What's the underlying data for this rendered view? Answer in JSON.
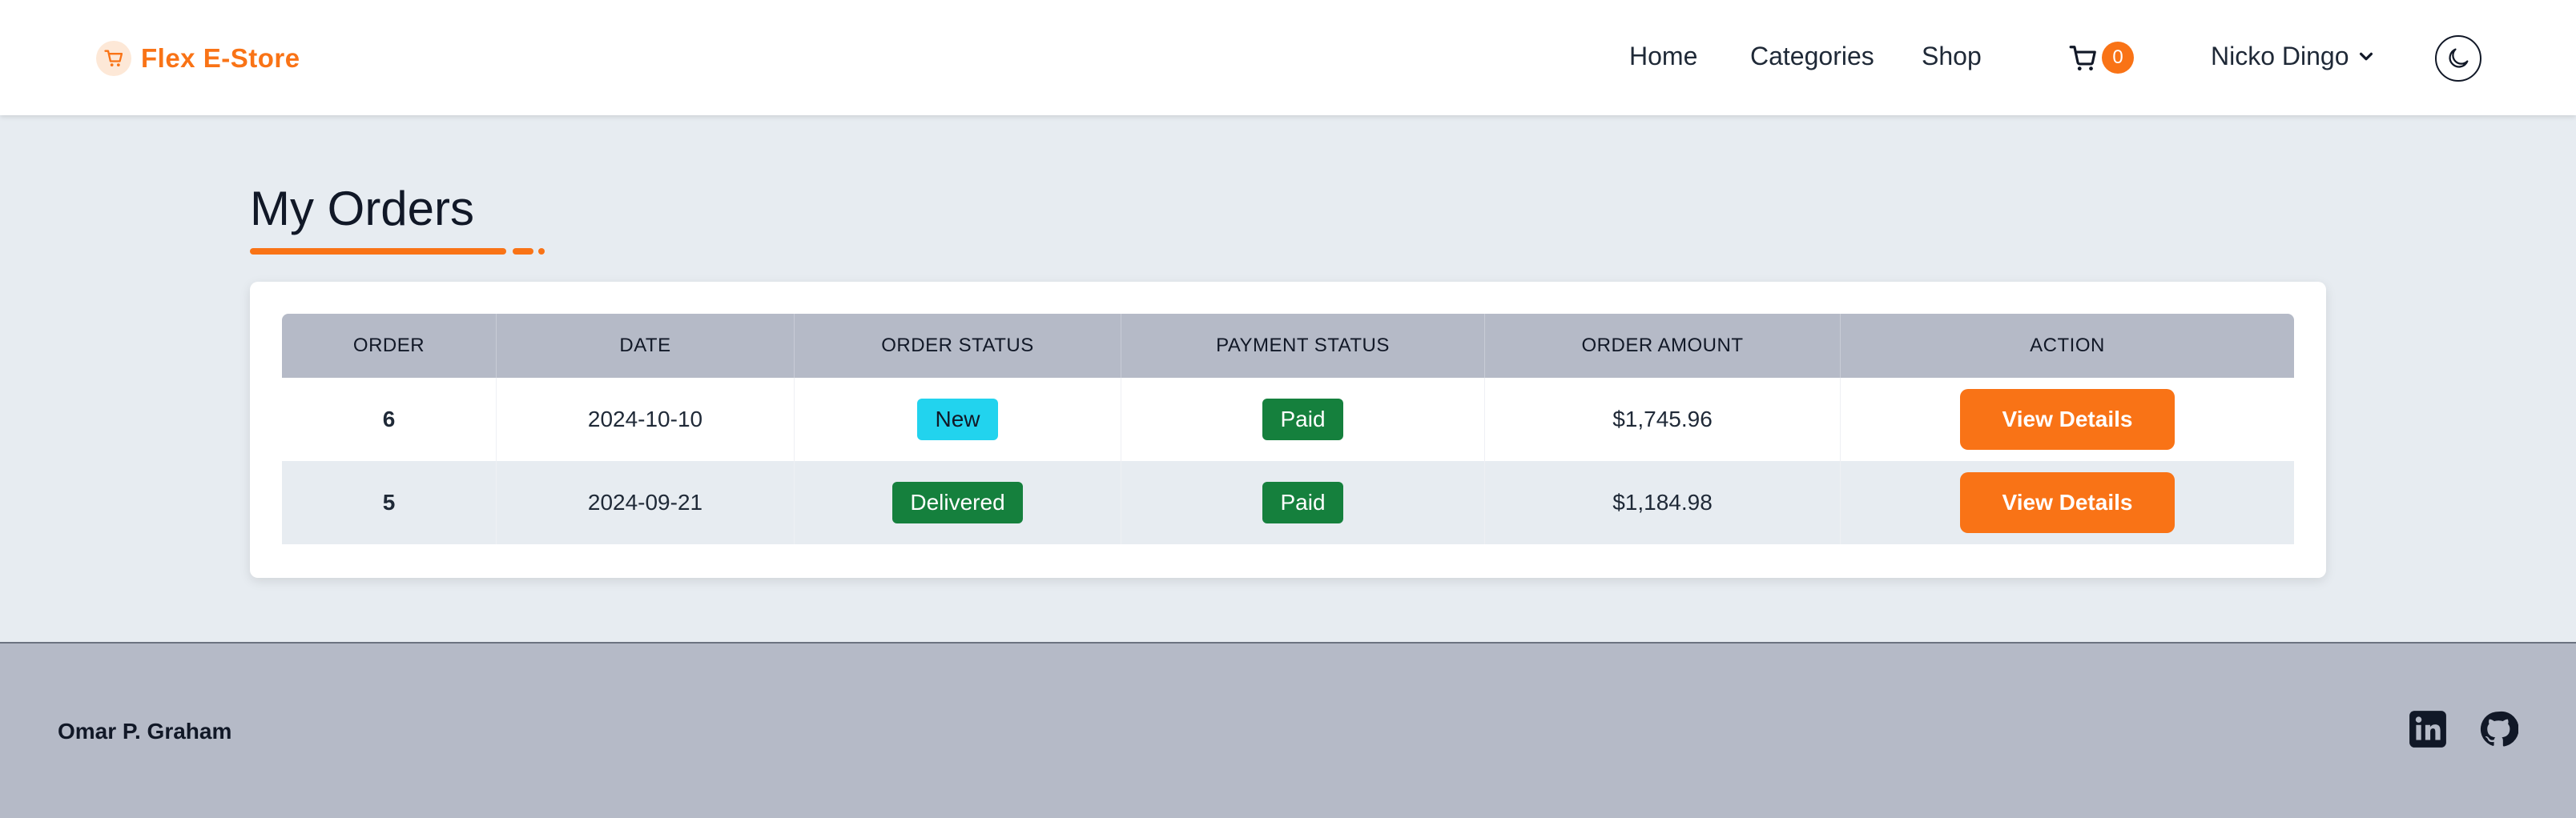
{
  "header": {
    "brand": "Flex E-Store",
    "nav": {
      "home": "Home",
      "categories": "Categories",
      "shop": "Shop"
    },
    "cart_count": "0",
    "user_name": "Nicko Dingo"
  },
  "main": {
    "title": "My Orders",
    "table": {
      "headers": [
        "ORDER",
        "DATE",
        "ORDER STATUS",
        "PAYMENT STATUS",
        "ORDER AMOUNT",
        "ACTION"
      ],
      "rows": [
        {
          "order": "6",
          "date": "2024-10-10",
          "order_status": "New",
          "payment_status": "Paid",
          "amount": "$1,745.96",
          "action": "View Details"
        },
        {
          "order": "5",
          "date": "2024-09-21",
          "order_status": "Delivered",
          "payment_status": "Paid",
          "amount": "$1,184.98",
          "action": "View Details"
        }
      ]
    }
  },
  "footer": {
    "name": "Omar P. Graham"
  },
  "colors": {
    "accent": "#f97316",
    "status_new": "#22d3ee",
    "status_green": "#15803d"
  }
}
